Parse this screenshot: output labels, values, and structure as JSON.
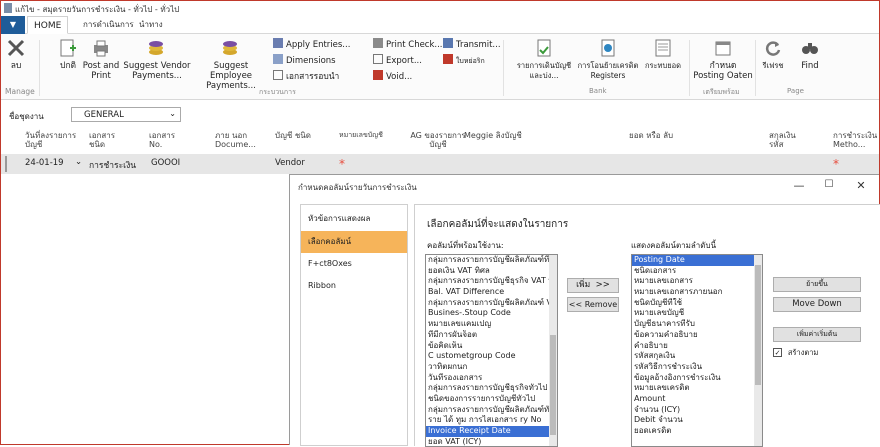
{
  "window": {
    "title": "แก้ไข - สมุดรายวันการชำระเงิน - ทั่วไป - ทั่วไป"
  },
  "tabs": {
    "file": "▼",
    "home": "HOME",
    "actions": "การดำเนินการ",
    "navigate": "นำทาง"
  },
  "ribbon": {
    "delete": "ลบ",
    "manage": "Manage",
    "post": "ปกติ",
    "post_print": "Post and Print",
    "suggest_vendor": "Suggest Vendor Payments...",
    "suggest_employee": "Suggest Employee Payments...",
    "apply_entries": "Apply Entries...",
    "dimensions": "Dimensions",
    "docs": "เอกสารรอบนำ",
    "print_check": "Print Check...",
    "export": "Export...",
    "void": "Void...",
    "transmit": "Transmit...",
    "transmit_sub": "ใบหย่อริก",
    "group_process": "กระบวนการ",
    "bank_recon": "รายการเดินบัญชีและบ่ง...",
    "bank_reg": "การโอนย้ายเครดิต Registers",
    "bank_stmt": "กระทบยอด",
    "group_bank": "Bank",
    "posting_date_btn": "กำหนด Posting Oaten",
    "group_page_sub": "เตรียมพร้อม",
    "refresh": "รีเฟรช",
    "find": "Find",
    "group_page": "Page"
  },
  "filter": {
    "label": "ชื่อชุดงาน",
    "value": "GENERAL"
  },
  "columns": [
    "วันที่ลงรายการบัญชี",
    "เอกสาร ชนิด",
    "เอกสาร No.",
    "ภาย นอก Docume...",
    "บัญชี ชนิด",
    "หมายเลขบัญชี",
    "AG ของรายการบัญชี",
    "Meggie ลิงบัญชี",
    "ยอด หรือ ลับ",
    "สกุลเงิน รหัส",
    "การชำระเงิน Metho..."
  ],
  "row": {
    "date": "24-01-19",
    "doc_type": "การชำระเงิน",
    "doc_no": "GOOOI",
    "acct_type": "Vendor",
    "star": "*"
  },
  "dialog": {
    "title": "กำหนดคอลัมน์รายวันการชำระเงิน",
    "nav": [
      "หัวข้อการแสดงผล",
      "เลือกคอลัมน์",
      "F+ct8Oxes",
      "Ribbon"
    ],
    "heading": "เลือกคอลัมน์ที่จะแสดงในรายการ",
    "available_label": "คอลัมน์ที่พร้อมใช้งาน:",
    "shown_label": "แสดงคอลัมน์ตามลำดับนี้",
    "available": [
      "กลุ่มการลงรายการบัญชีผลิตภัณฑ์ที่ปรับปรุง",
      "ยอดเงิน VAT ทิศล",
      "กลุ่มการลงรายการบัญชีธุรกิจ VAT ที่ปรับปรุง",
      "Bal. VAT Difference",
      "กลุ่มการลงรายการบัญชีผลิตภัณฑ์ VAT ที่ปรับปรุง",
      "Busines-.Stoup Code",
      "หมายเลขแคมเปญ",
      "ที่มีการผันจ็อต",
      "ข้อคิดเห็น",
      "C ustometgroup Code",
      "วาทิตผกนก",
      "วันที่รองเอกสาร",
      "กลุ่มการลงรายการบัญชีธุรกิจทั่วไป",
      "ชนิดของการรายการบัญชีทั่วไป",
      "กลุ่มการลงรายการบัญชีผลิตภัณฑ์ทั่วไป",
      "ราย ได้ ทูม การไสเอกสาร ry No",
      "Invoice Receipt Date",
      "ยอด VAT (ICY)"
    ],
    "shown": [
      "Posting Date",
      "ชนิดเอกสาร",
      "หมายเลขเอกสาร",
      "หมายเลขเอกสารภายนอก",
      "ชนิดบัญชีที่ใช้",
      "หมายเลขบัญชี",
      "บัญชีธนาคารที่รับ",
      "ข้อความคำอธิบาย",
      "คำอธิบาย",
      "รหัสสกุลเงิน",
      "รหัสวิธีการชำระเงิน",
      "ข้อมูลอ้างอิงการชำระเงิน",
      "หมายเลขเครดิต",
      "Amount",
      "จำนวน (ICY)",
      "Debit จำนวน",
      "ยอดเครดิต"
    ],
    "add_btn": "เพิ่ม",
    "add_arrow": ">>",
    "remove_btn": "<< Remove",
    "move_up": "ย้ายขึ้น",
    "move_down": "Move Down",
    "add_default": "เพิ่มค่าเริ่มต้น",
    "check_label": "สร้างตาม"
  }
}
